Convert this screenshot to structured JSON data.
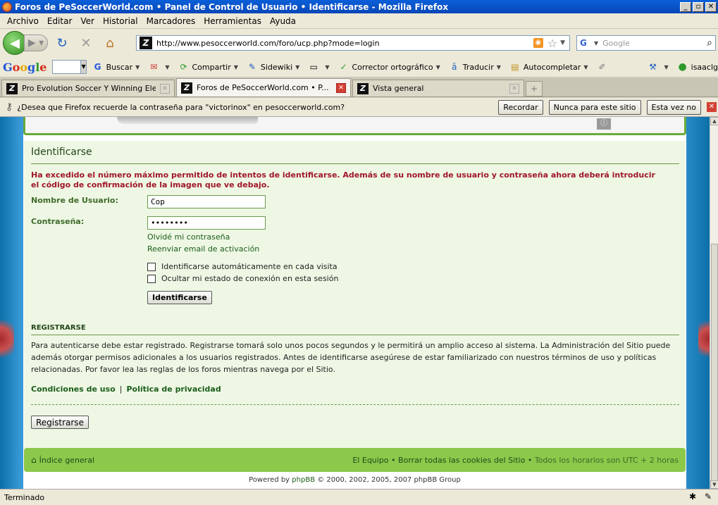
{
  "window": {
    "title": "Foros de PeSoccerWorld.com • Panel de Control de Usuario • Identificarse - Mozilla Firefox"
  },
  "menu": [
    "Archivo",
    "Editar",
    "Ver",
    "Historial",
    "Marcadores",
    "Herramientas",
    "Ayuda"
  ],
  "nav": {
    "url": "http://www.pesoccerworld.com/foro/ucp.php?mode=login",
    "search_placeholder": "Google"
  },
  "gtoolbar": {
    "logo": {
      "g1": "G",
      "o1": "o",
      "o2": "o",
      "g2": "g",
      "l": "l",
      "e": "e"
    },
    "buscar": "Buscar",
    "compartir": "Compartir",
    "sidewiki": "Sidewiki",
    "corrector": "Corrector ortográfico",
    "traducir": "Traducir",
    "autocompletar": "Autocompletar",
    "user": "isaaclg"
  },
  "tabs": [
    {
      "label": "Pro Evolution Soccer Y Winning Eleven ..."
    },
    {
      "label": "Foros de PeSoccerWorld.com • P..."
    },
    {
      "label": "Vista general"
    }
  ],
  "notification": {
    "message": "¿Desea que Firefox recuerde la contraseña para \"victorinox\" en pesoccerworld.com?",
    "remember": "Recordar",
    "never": "Nunca para este sitio",
    "not_now": "Esta vez no"
  },
  "login": {
    "title": "Identificarse",
    "error": "Ha excedido el número máximo permitido de intentos de identificarse. Además de su nombre de usuario y contraseña ahora deberá introducir el código de confirmación de la imagen que ve debajo.",
    "username_label": "Nombre de Usuario:",
    "username_value": "Cop",
    "password_label": "Contraseña:",
    "password_value": "••••••••",
    "forgot_password": "Olvidé mi contraseña",
    "resend_activation": "Reenviar email de activación",
    "auto_login": "Identificarse automáticamente en cada visita",
    "hide_status": "Ocultar mi estado de conexión en esta sesión",
    "submit": "Identificarse"
  },
  "register": {
    "title": "REGISTRARSE",
    "text": "Para autenticarse debe estar registrado. Registrarse tomará solo unos pocos segundos y le permitirá un amplio acceso al sistema. La Administración del Sitio puede además otorgar permisos adicionales a los usuarios registrados. Antes de identificarse asegúrese de estar familiarizado con nuestros términos de uso y políticas relacionadas. Por favor lea las reglas de los foros mientras navega por el Sitio.",
    "terms": "Condiciones de uso",
    "separator": "|",
    "privacy": "Política de privacidad",
    "button": "Registrarse"
  },
  "footer": {
    "index": "Índice general",
    "team": "El Equipo",
    "bullet": "•",
    "cookies": "Borrar todas las cookies del Sitio",
    "timezone": "Todos los horarios son UTC + 2 horas",
    "powered_prefix": "Powered by",
    "powered_brand": "phpBB",
    "powered_suffix": "© 2000, 2002, 2005, 2007 phpBB Group"
  },
  "status": {
    "text": "Terminado"
  }
}
